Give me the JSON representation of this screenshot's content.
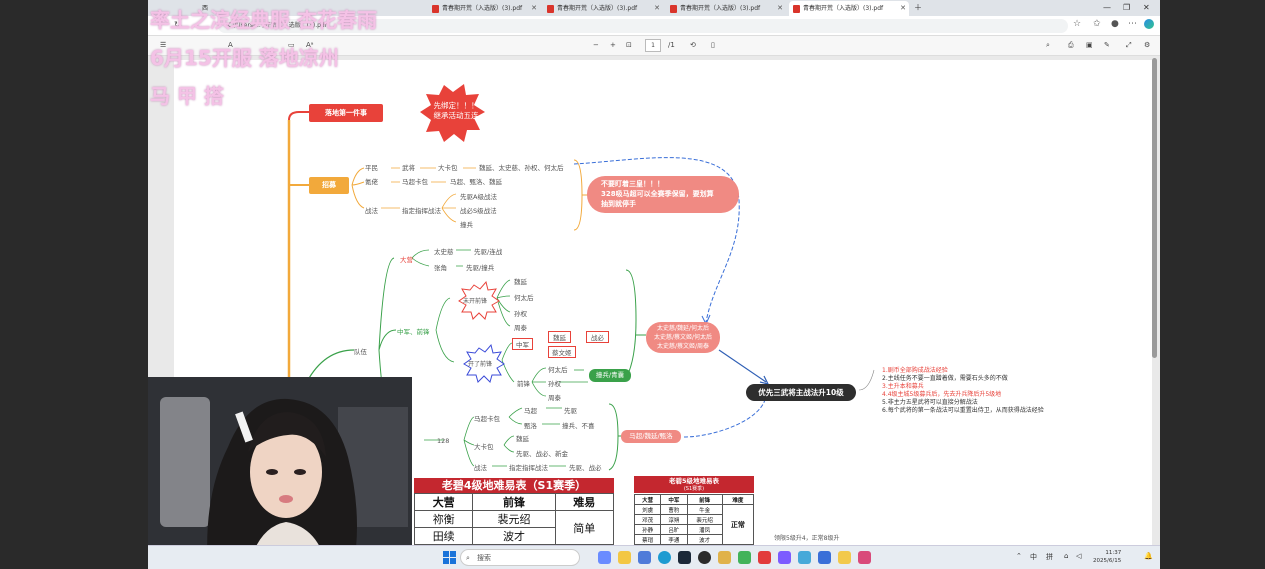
{
  "overlay": {
    "line1": "率土之滨经典服 杏花春雨",
    "line2": "6月15开服    落地凉州",
    "line3": "马 甲 搭"
  },
  "browser": {
    "tabs": [
      {
        "label": "西"
      },
      {
        "label": "青春期开荒（入选版）(3).pdf"
      },
      {
        "label": "青春期开荒（入选版）(3).pdf"
      },
      {
        "label": "青春期开荒（入选版）(3).pdf"
      },
      {
        "label": "青春期开荒（入选版）(3).pdf"
      }
    ],
    "address": "C:/Users/... /开荒（入选版）(3).pdf",
    "page_current": "1",
    "page_total": "/1"
  },
  "mindmap": {
    "root1": "落地第一件事",
    "burst1_line1": "先绑定！！！",
    "burst1_line2": "继承活动五连",
    "recruit": "招募",
    "r_free": "平民",
    "r_wujiang": "武将",
    "r_big": "大卡包",
    "r_bigres": "魏延、太史慈、孙权、何太后",
    "r_jiance": "氪佬",
    "r_ma": "马超卡包",
    "r_mares": "马超、甄洛、魏延",
    "r_zhanfa": "战法",
    "r_zhiding": "指定指挥战法",
    "r_xian": "先驱A级战法",
    "r_zhanbi": "战必S级战法",
    "r_bubing": "撞兵",
    "warn_line1": "不要盯着三皇！！！",
    "warn_line2": "328吸马超可以全赛季保留，要划算",
    "warn_line3": "抽到就停手",
    "team": "队伍",
    "dayin": "大营",
    "tsc": "太史慈",
    "tsc_res": "先驱/连战",
    "zj": "张角",
    "zj_res": "先驱/撞兵",
    "zq": "中军、前锋",
    "notopen": "未开前锋",
    "n1": "魏延",
    "n2": "何太后",
    "n3": "孙权",
    "n4": "周泰",
    "opened": "开了前锋",
    "zhongjun": "中军",
    "o1": "魏延",
    "o_res": "战必",
    "o2": "蔡文姬",
    "qf": "前锋",
    "q1": "何太后",
    "q2": "孙权",
    "q3": "周泰",
    "green1": "撞兵/青囊",
    "combo_line1": "太史慈/魏延/何太后",
    "combo_line2": "太史慈/蔡文姬/何太后",
    "combo_line3": "太史慈/蔡文姬/周泰",
    "n128": "128",
    "mc_pack": "马超卡包",
    "mc1": "马超",
    "mc1r": "先驱",
    "mc2": "甄洛",
    "mc2r": "撞兵、不喜",
    "bigpack": "大卡包",
    "b1": "魏延",
    "b2": "先驱、战必、新金",
    "zf": "战法",
    "zf1": "指定指挥战法",
    "zf2": "先驱、战必",
    "combo2": "马超/魏延/甄洛",
    "priority": "优先三武将主战法升10级",
    "tips": [
      "1.剧币全部购成战法经验",
      "2.主线任务不要一直蹭着做，需要石头多的不做",
      "3.主升本和募兵",
      "4.4级主城5级募兵后，先去升兵降后升5级地",
      "5.非主力五星武将可以直接分解战法",
      "6.每个武将的第一条战法可以重置出侍卫，从而获得战法经验"
    ],
    "note_bottom": "领限5级升4，正常8级升"
  },
  "table_s1": {
    "title": "老碧4级地难易表（S1赛季）",
    "headers": [
      "大营",
      "前锋",
      "难易"
    ],
    "rows": [
      [
        "祢衡",
        "裴元绍",
        "简单"
      ],
      [
        "田续",
        "波才",
        ""
      ]
    ]
  },
  "table_s5": {
    "title": "老碧5级地难易表",
    "subtitle": "(S1赛季)",
    "headers": [
      "大营",
      "中军",
      "前锋",
      "难度"
    ],
    "rows": [
      [
        "刘虞",
        "曹豹",
        "牛金",
        ""
      ],
      [
        "邓茂",
        "淳朔",
        "裴元绍",
        "正常"
      ],
      [
        "孙静",
        "吕旷",
        "潘凤",
        ""
      ],
      [
        "蔡瑁",
        "李通",
        "波才",
        ""
      ]
    ]
  },
  "taskbar": {
    "search": "搜索",
    "lang1": "中",
    "lang2": "拼",
    "time": "11:37",
    "date": "2025/6/15"
  },
  "colors": {
    "red": "#e8423a",
    "orange": "#f2a93b",
    "green": "#3aa14a",
    "pink": "#f08a83",
    "dark": "#2e2e2e"
  }
}
